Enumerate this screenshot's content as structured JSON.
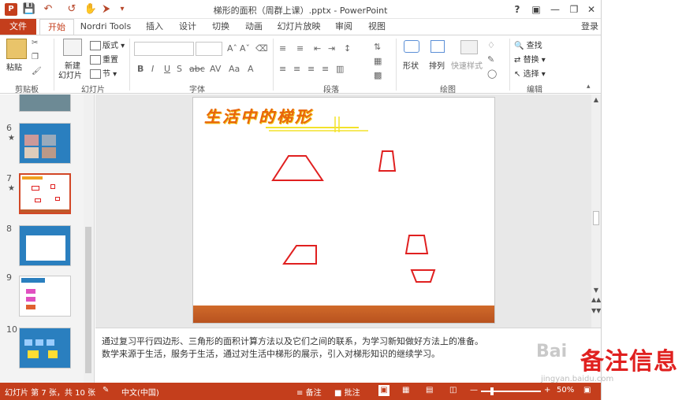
{
  "window": {
    "title": "梯形的面积（周群上课）.pptx - PowerPoint",
    "help": "?",
    "login": "登录"
  },
  "tabs": [
    "文件",
    "开始",
    "Nordri Tools",
    "插入",
    "设计",
    "切换",
    "动画",
    "幻灯片放映",
    "审阅",
    "视图"
  ],
  "ribbon": {
    "clipboard": {
      "label": "剪贴板",
      "paste": "粘贴"
    },
    "slides": {
      "label": "幻灯片",
      "new_slide": "新建",
      "new_slide2": "幻灯片",
      "layout": "版式",
      "reset": "重置",
      "section": "节"
    },
    "font": {
      "label": "字体",
      "font_name": "",
      "font_size": ""
    },
    "paragraph": {
      "label": "段落"
    },
    "drawing": {
      "label": "绘图",
      "shapes": "形状",
      "arrange": "排列",
      "quick_styles": "快速样式"
    },
    "editing": {
      "label": "编辑",
      "find": "查找",
      "replace": "替换",
      "select": "选择"
    }
  },
  "thumbnails": [
    {
      "num": "6",
      "star": "★"
    },
    {
      "num": "7",
      "star": "★"
    },
    {
      "num": "8",
      "star": ""
    },
    {
      "num": "9",
      "star": ""
    },
    {
      "num": "10",
      "star": ""
    }
  ],
  "slide": {
    "title": "生活中的梯形"
  },
  "notes": {
    "line1": "通过复习平行四边形、三角形的面积计算方法以及它们之间的联系，为学习新知做好方法上的准备。",
    "line2": "数学来源于生活，服务于生活，通过对生活中梯形的展示，引入对梯形知识的继续学习。"
  },
  "status": {
    "slide_pos": "幻灯片 第 7 张，共 10 张",
    "language": "中文(中国)",
    "notes_btn": "备注",
    "comments_btn": "批注",
    "zoom": "50%"
  },
  "watermark": {
    "text": "备注信息",
    "baidu": "Bai",
    "url": "jingyan.baidu.com"
  },
  "colors": {
    "accent": "#c43e1c",
    "trapezoid": "#e02020"
  }
}
